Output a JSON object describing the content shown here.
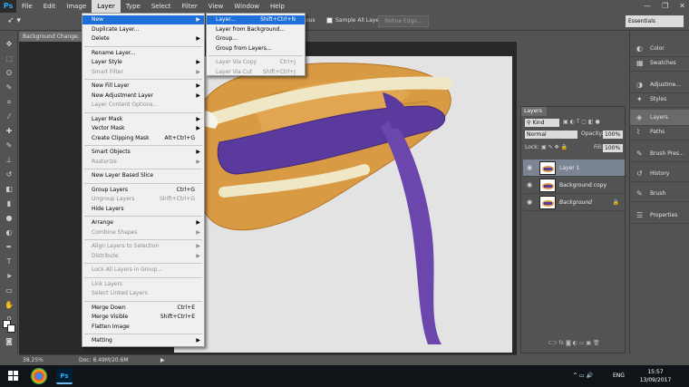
{
  "menubar": {
    "logo": "Ps",
    "items": [
      "File",
      "Edit",
      "Image",
      "Layer",
      "Type",
      "Select",
      "Filter",
      "View",
      "Window",
      "Help"
    ],
    "active": "Layer",
    "window_controls": [
      "—",
      "❐",
      "✕"
    ]
  },
  "options": {
    "tool_glyph": "➶ ▾",
    "partial_check_label": "ous",
    "sample_all_label": "Sample All Layers",
    "refine_edge": "Refine Edge...",
    "workspace": "Essentials"
  },
  "document": {
    "tab_label": "Background Change.",
    "zoom": "38.25%",
    "doc_size": "Doc: 8.49M/20.6M",
    "status_arrow": "▶"
  },
  "layer_menu": {
    "items": [
      {
        "label": "New",
        "shortcut": "",
        "submenu": true,
        "disabled": false,
        "highlight": true
      },
      {
        "label": "Duplicate Layer...",
        "shortcut": "",
        "submenu": false,
        "disabled": false
      },
      {
        "label": "Delete",
        "shortcut": "",
        "submenu": true,
        "disabled": false
      },
      {
        "sep": true
      },
      {
        "label": "Rename Layer...",
        "shortcut": "",
        "submenu": false,
        "disabled": false
      },
      {
        "label": "Layer Style",
        "shortcut": "",
        "submenu": true,
        "disabled": false
      },
      {
        "label": "Smart Filter",
        "shortcut": "",
        "submenu": true,
        "disabled": true
      },
      {
        "sep": true
      },
      {
        "label": "New Fill Layer",
        "shortcut": "",
        "submenu": true,
        "disabled": false
      },
      {
        "label": "New Adjustment Layer",
        "shortcut": "",
        "submenu": true,
        "disabled": false
      },
      {
        "label": "Layer Content Options...",
        "shortcut": "",
        "submenu": false,
        "disabled": true
      },
      {
        "sep": true
      },
      {
        "label": "Layer Mask",
        "shortcut": "",
        "submenu": true,
        "disabled": false
      },
      {
        "label": "Vector Mask",
        "shortcut": "",
        "submenu": true,
        "disabled": false
      },
      {
        "label": "Create Clipping Mask",
        "shortcut": "Alt+Ctrl+G",
        "submenu": false,
        "disabled": false
      },
      {
        "sep": true
      },
      {
        "label": "Smart Objects",
        "shortcut": "",
        "submenu": true,
        "disabled": false
      },
      {
        "label": "Rasterize",
        "shortcut": "",
        "submenu": true,
        "disabled": true
      },
      {
        "sep": true
      },
      {
        "label": "New Layer Based Slice",
        "shortcut": "",
        "submenu": false,
        "disabled": false
      },
      {
        "sep": true
      },
      {
        "label": "Group Layers",
        "shortcut": "Ctrl+G",
        "submenu": false,
        "disabled": false
      },
      {
        "label": "Ungroup Layers",
        "shortcut": "Shift+Ctrl+G",
        "submenu": false,
        "disabled": true
      },
      {
        "label": "Hide Layers",
        "shortcut": "",
        "submenu": false,
        "disabled": false
      },
      {
        "sep": true
      },
      {
        "label": "Arrange",
        "shortcut": "",
        "submenu": true,
        "disabled": false
      },
      {
        "label": "Combine Shapes",
        "shortcut": "",
        "submenu": true,
        "disabled": true
      },
      {
        "sep": true
      },
      {
        "label": "Align Layers to Selection",
        "shortcut": "",
        "submenu": true,
        "disabled": true
      },
      {
        "label": "Distribute",
        "shortcut": "",
        "submenu": true,
        "disabled": true
      },
      {
        "sep": true
      },
      {
        "label": "Lock All Layers in Group...",
        "shortcut": "",
        "submenu": false,
        "disabled": true
      },
      {
        "sep": true
      },
      {
        "label": "Link Layers",
        "shortcut": "",
        "submenu": false,
        "disabled": true
      },
      {
        "label": "Select Linked Layers",
        "shortcut": "",
        "submenu": false,
        "disabled": true
      },
      {
        "sep": true
      },
      {
        "label": "Merge Down",
        "shortcut": "Ctrl+E",
        "submenu": false,
        "disabled": false
      },
      {
        "label": "Merge Visible",
        "shortcut": "Shift+Ctrl+E",
        "submenu": false,
        "disabled": false
      },
      {
        "label": "Flatten Image",
        "shortcut": "",
        "submenu": false,
        "disabled": false
      },
      {
        "sep": true
      },
      {
        "label": "Matting",
        "shortcut": "",
        "submenu": true,
        "disabled": false
      }
    ]
  },
  "new_submenu": {
    "items": [
      {
        "label": "Layer...",
        "shortcut": "Shift+Ctrl+N",
        "disabled": false,
        "highlight": true
      },
      {
        "label": "Layer from Background...",
        "shortcut": "",
        "disabled": false
      },
      {
        "label": "Group...",
        "shortcut": "",
        "disabled": false
      },
      {
        "label": "Group from Layers...",
        "shortcut": "",
        "disabled": false
      },
      {
        "sep": true
      },
      {
        "label": "Layer Via Copy",
        "shortcut": "Ctrl+J",
        "disabled": true
      },
      {
        "label": "Layer Via Cut",
        "shortcut": "Shift+Ctrl+J",
        "disabled": true
      }
    ]
  },
  "mini_panels": {
    "items": [
      {
        "label": "Color",
        "icon": "◐"
      },
      {
        "label": "Swatches",
        "icon": "▦"
      },
      {
        "label": "Adjustme...",
        "icon": "◑"
      },
      {
        "label": "Styles",
        "icon": "✦"
      },
      {
        "label": "Layers",
        "icon": "◈",
        "selected": true
      },
      {
        "label": "Paths",
        "icon": "⌇"
      },
      {
        "label": "Brush Pres...",
        "icon": "✎"
      },
      {
        "label": "History",
        "icon": "↺"
      },
      {
        "label": "Brush",
        "icon": "✎"
      },
      {
        "label": "Properties",
        "icon": "☰"
      }
    ]
  },
  "layers_panel": {
    "tab": "Layers",
    "kind_label": "Kind",
    "filter_icons": "▣ ◐ T ▢ ◧ ●",
    "blend_mode": "Normal",
    "opacity_label": "Opacity:",
    "opacity": "100%",
    "lock_label": "Lock:",
    "lock_icons": "▣ ✎ ✥ 🔒",
    "fill_label": "Fill:",
    "fill": "100%",
    "layers": [
      {
        "name": "Layer 1",
        "selected": true,
        "italic": false,
        "locked": false
      },
      {
        "name": "Background copy",
        "selected": false,
        "italic": false,
        "locked": false
      },
      {
        "name": "Background",
        "selected": false,
        "italic": true,
        "locked": true
      }
    ],
    "bottom_icons": "⊂⊃  fx  ◙  ◐  ▭  ▣  🗑"
  },
  "taskbar": {
    "time": "15:57",
    "date": "13/09/2017",
    "lang": "ENG",
    "tray_icons": "^  ▭  🔊",
    "ps_label": "Ps"
  },
  "colors": {
    "menu_highlight": "#1e6fd9",
    "hat_straw": "#d99a44",
    "ribbon": "#5b3a9e"
  }
}
